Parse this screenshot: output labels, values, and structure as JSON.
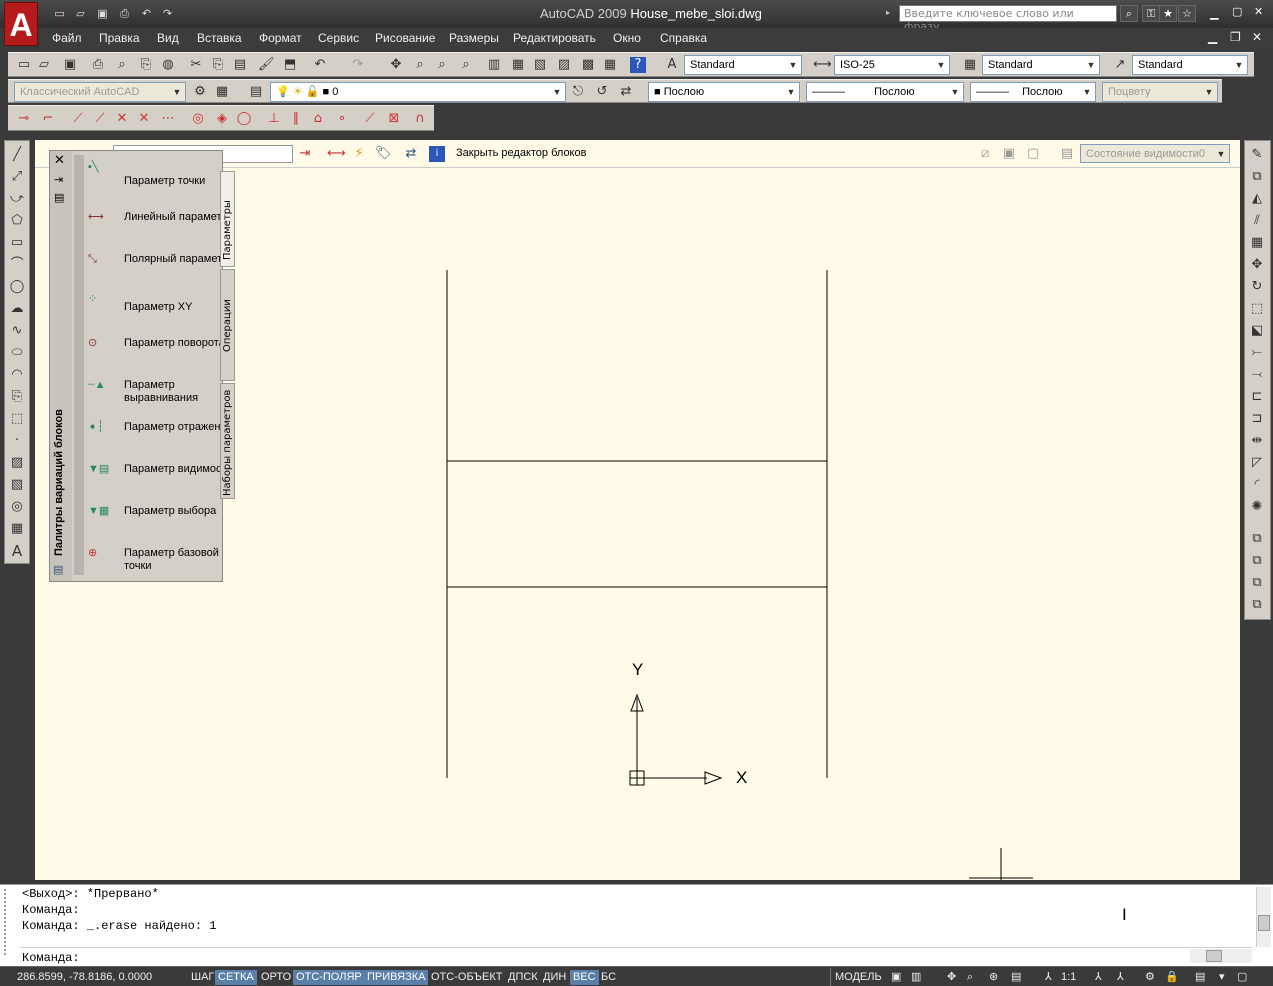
{
  "app": {
    "title_prefix": "AutoCAD 2009",
    "filename": "House_mebe_sloi.dwg",
    "logo": "A",
    "search_placeholder": "Введите ключевое слово или фразу"
  },
  "menu": [
    "Файл",
    "Правка",
    "Вид",
    "Вставка",
    "Формат",
    "Сервис",
    "Рисование",
    "Размеры",
    "Редактировать",
    "Окно",
    "Справка"
  ],
  "toolbar1": {
    "text_style": "Standard",
    "dim_style": "ISO-25",
    "table_style": "Standard",
    "mleader_style": "Standard"
  },
  "toolbar2": {
    "workspace": "Классический AutoCAD",
    "layer": "0",
    "color": "Послою",
    "linetype": "Послою",
    "lineweight": "Послою",
    "plotstyle": "Поцвету"
  },
  "block_editor": {
    "close_label": "Закрыть редактор блоков",
    "visibility_state": "Состояние видимости0"
  },
  "palette": {
    "title": "Палитры вариаций блоков",
    "tabs": [
      "Параметры",
      "Операции",
      "Наборы параметров"
    ],
    "items": [
      {
        "label": "Параметр точки",
        "icon": "point-parameter-icon"
      },
      {
        "label": "Линейный параметр",
        "icon": "linear-parameter-icon"
      },
      {
        "label": "Полярный параметр",
        "icon": "polar-parameter-icon"
      },
      {
        "label": "Параметр XY",
        "icon": "xy-parameter-icon"
      },
      {
        "label": "Параметр поворота",
        "icon": "rotation-parameter-icon"
      },
      {
        "label": "Параметр выравнивания",
        "icon": "alignment-parameter-icon"
      },
      {
        "label": "Параметр отражения",
        "icon": "flip-parameter-icon"
      },
      {
        "label": "Параметр видимости",
        "icon": "visibility-parameter-icon"
      },
      {
        "label": "Параметр выбора",
        "icon": "lookup-parameter-icon"
      },
      {
        "label": "Параметр базовой точки",
        "icon": "basepoint-parameter-icon"
      }
    ]
  },
  "ucs": {
    "x_label": "X",
    "y_label": "Y"
  },
  "command": {
    "lines": [
      "<Выход>: *Прервано*",
      "Команда:",
      "Команда: _.erase найдено: 1"
    ],
    "prompt": "Команда:"
  },
  "status": {
    "coords": "286.8599, -78.8186, 0.0000",
    "toggles": [
      {
        "label": "ШАГ",
        "on": false
      },
      {
        "label": "СЕТКА",
        "on": true
      },
      {
        "label": "ОРТО",
        "on": false
      },
      {
        "label": "ОТС-ПОЛЯР",
        "on": true
      },
      {
        "label": "ПРИВЯЗКА",
        "on": true
      },
      {
        "label": "ОТС-ОБЪЕКТ",
        "on": false
      },
      {
        "label": "ДПСК",
        "on": false
      },
      {
        "label": "ДИН",
        "on": false
      },
      {
        "label": "ВЕС",
        "on": true
      },
      {
        "label": "БС",
        "on": false
      }
    ],
    "model_label": "МОДЕЛЬ",
    "scale": "1:1"
  },
  "colors": {
    "canvas": "#fffbe8",
    "toggle_on": "#5a7fa8",
    "logo": "#b51b1b"
  }
}
